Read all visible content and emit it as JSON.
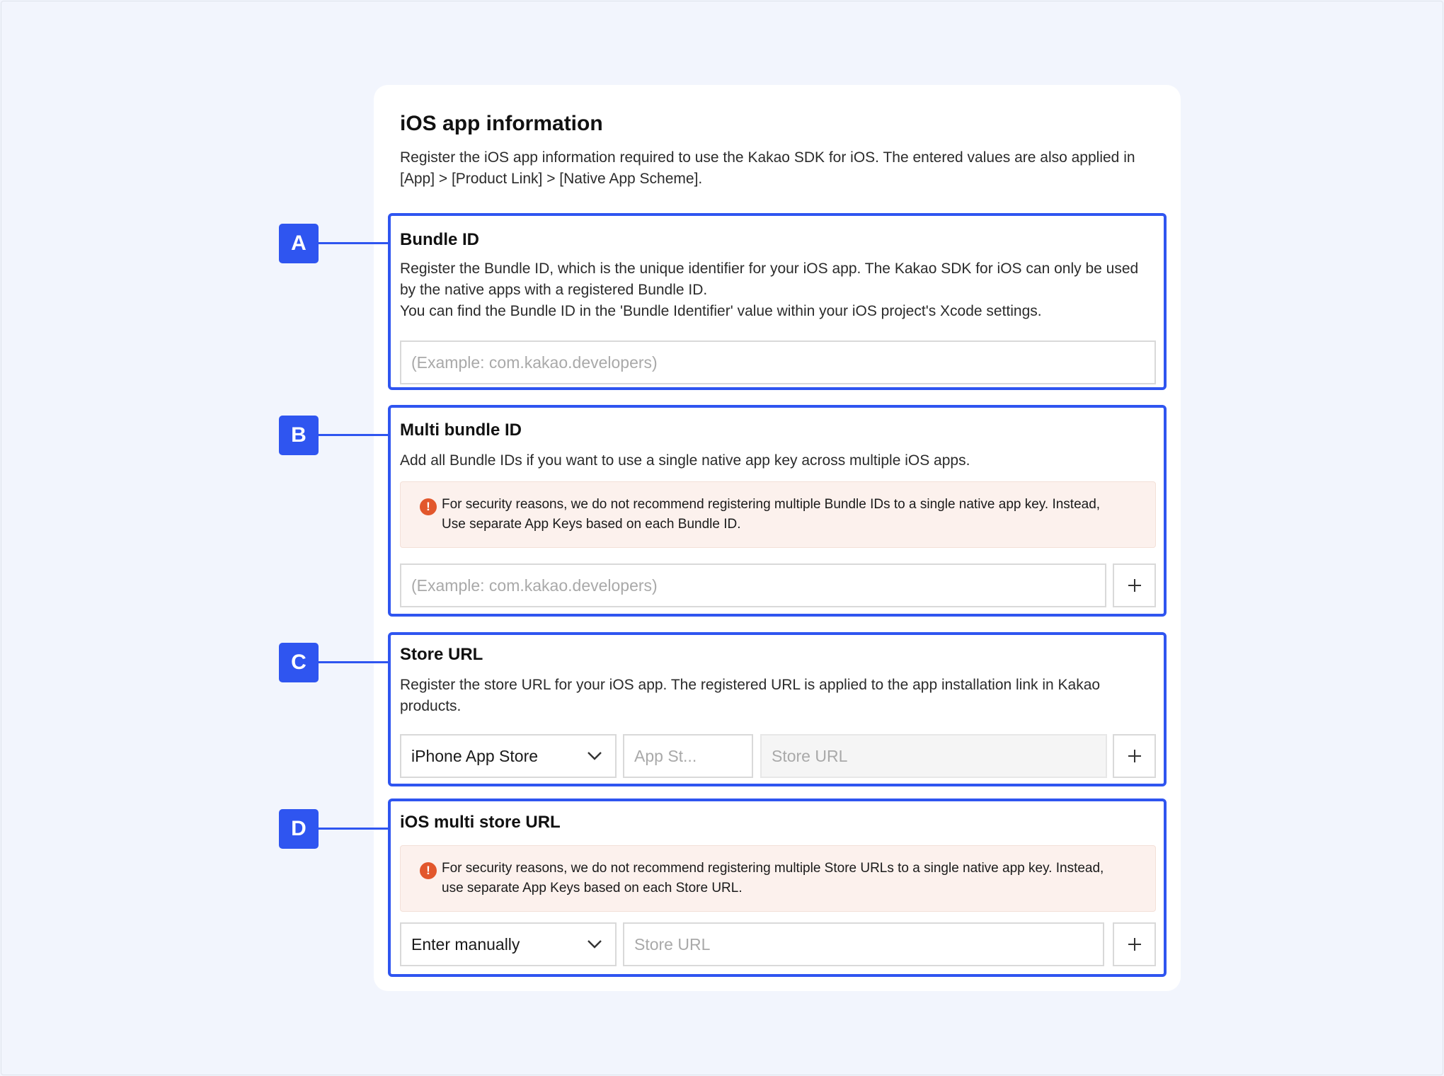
{
  "header": {
    "title": "iOS app information",
    "description_line1": "Register the iOS app information required to use the Kakao SDK for iOS. The entered values are also applied in",
    "description_line2": "[App] > [Product Link] > [Native App Scheme]."
  },
  "markers": [
    "A",
    "B",
    "C",
    "D"
  ],
  "bundle_id": {
    "title": "Bundle ID",
    "desc_line1": "Register the Bundle ID, which is the unique identifier for your iOS app. The Kakao SDK for iOS can only be used",
    "desc_line2": "by the native apps with a registered Bundle ID.",
    "desc_line3": "You can find the Bundle ID in the 'Bundle Identifier' value within your iOS project's Xcode settings.",
    "input_placeholder": "(Example: com.kakao.developers)",
    "input_value": ""
  },
  "multi_bundle_id": {
    "title": "Multi bundle ID",
    "desc": "Add all Bundle IDs if you want to use a single native app key across multiple iOS apps.",
    "warning_icon": "exclamation-circle-icon",
    "warning_line1": "For security reasons, we do not recommend registering multiple Bundle IDs to a single native app key. Instead,",
    "warning_line2": "Use separate App Keys based on each Bundle ID.",
    "input_placeholder": "(Example: com.kakao.developers)",
    "input_value": "",
    "add_icon": "plus-icon"
  },
  "store_url": {
    "title": "Store URL",
    "desc_line1": "Register the store URL for your iOS app. The registered URL is applied to the app installation link in Kakao",
    "desc_line2": "products.",
    "store_select_value": "iPhone App Store",
    "app_store_id_placeholder": "App St...",
    "store_url_placeholder": "Store URL",
    "add_icon": "plus-icon"
  },
  "ios_multi_store_url": {
    "title": "iOS multi store URL",
    "warning_icon": "exclamation-circle-icon",
    "warning_line1": "For security reasons, we do not recommend registering multiple Store URLs to a single native app key. Instead,",
    "warning_line2": "use separate App Keys based on each Store URL.",
    "mode_select_value": "Enter manually",
    "store_url_placeholder": "Store URL",
    "add_icon": "plus-icon"
  },
  "colors": {
    "accent": "#2f55f0",
    "background": "#f2f5fd",
    "warning_bg": "#fcf1ed",
    "warning_icon": "#e2572c"
  }
}
